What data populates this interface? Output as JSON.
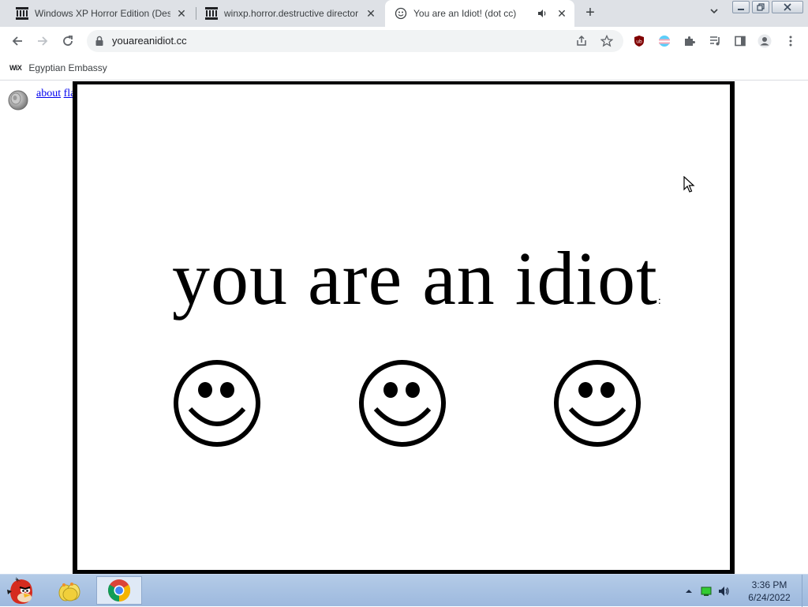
{
  "tabs": [
    {
      "title": "Windows XP Horror Edition (Dest",
      "favicon": "museum-icon"
    },
    {
      "title": "winxp.horror.destructive director",
      "favicon": "museum-icon"
    },
    {
      "title": "You are an Idiot! (dot cc)",
      "favicon": "smiley-icon",
      "active": true,
      "audio": "speaker-icon"
    }
  ],
  "toolbar": {
    "url": "youareanidiot.cc"
  },
  "bookmarks": [
    {
      "label": "Egyptian Embassy",
      "icon_text": "WiX"
    }
  ],
  "page": {
    "links": [
      "about",
      "flash"
    ],
    "headline": "you are an idiot",
    "headline_trail": ":",
    "smiley_count": 3
  },
  "taskbar": {
    "time": "3:36 PM",
    "date": "6/24/2022"
  },
  "colors": {
    "tabstrip": "#dee1e6",
    "link": "#0000ee",
    "frame": "#000000",
    "taskbar": "#9db9de"
  }
}
